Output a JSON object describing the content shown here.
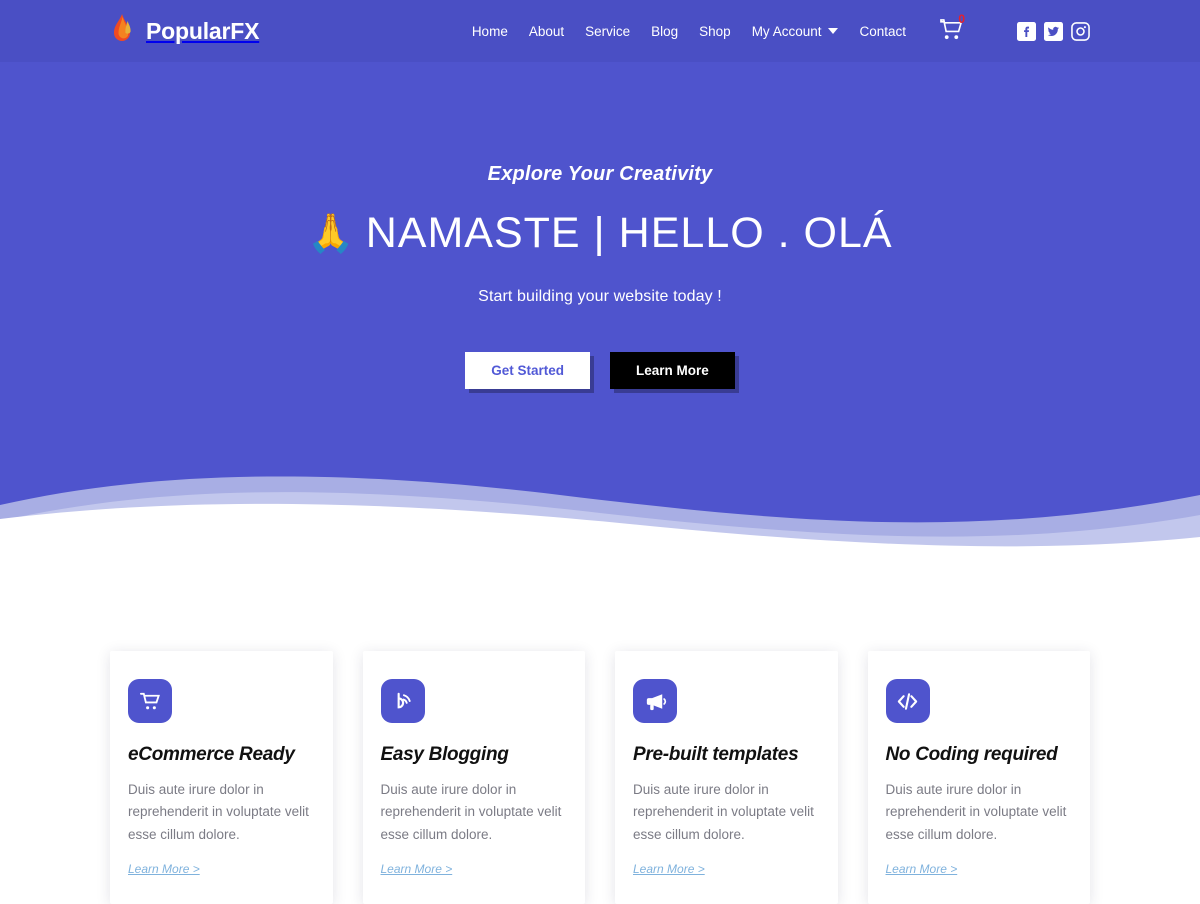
{
  "header": {
    "brand": {
      "name": "PopularFX",
      "logo_icon": "flame-icon"
    },
    "nav": [
      {
        "label": "Home",
        "has_dropdown": false
      },
      {
        "label": "About",
        "has_dropdown": false
      },
      {
        "label": "Service",
        "has_dropdown": false
      },
      {
        "label": "Blog",
        "has_dropdown": false
      },
      {
        "label": "Shop",
        "has_dropdown": false
      },
      {
        "label": "My Account",
        "has_dropdown": true
      },
      {
        "label": "Contact",
        "has_dropdown": false
      }
    ],
    "cart": {
      "icon": "shopping-cart-icon",
      "count": "0",
      "badge_color": "#e8202a"
    },
    "socials": [
      {
        "name": "facebook-icon"
      },
      {
        "name": "twitter-icon"
      },
      {
        "name": "instagram-icon"
      }
    ]
  },
  "hero": {
    "eyebrow": "Explore Your Creativity",
    "emoji": "🙏",
    "title": "NAMASTE | HELLO . OLÁ",
    "subtitle": "Start building your website today !",
    "primary_button": "Get Started",
    "secondary_button": "Learn More"
  },
  "features": {
    "link_label": "Learn More >",
    "body_text": "Duis aute irure dolor in reprehenderit in voluptate velit esse cillum dolore.",
    "cards": [
      {
        "icon": "shopping-cart-icon",
        "title": "eCommerce Ready"
      },
      {
        "icon": "blog-rss-icon",
        "title": "Easy Blogging"
      },
      {
        "icon": "megaphone-icon",
        "title": "Pre-built templates"
      },
      {
        "icon": "code-brackets-icon",
        "title": "No Coding required"
      }
    ]
  },
  "colors": {
    "header_bg": "#4a4fc4",
    "hero_bg": "#4f54cd",
    "wave_light": "#a8aee4",
    "page_bg": "#ffffff",
    "link": "#7fb2dd"
  }
}
